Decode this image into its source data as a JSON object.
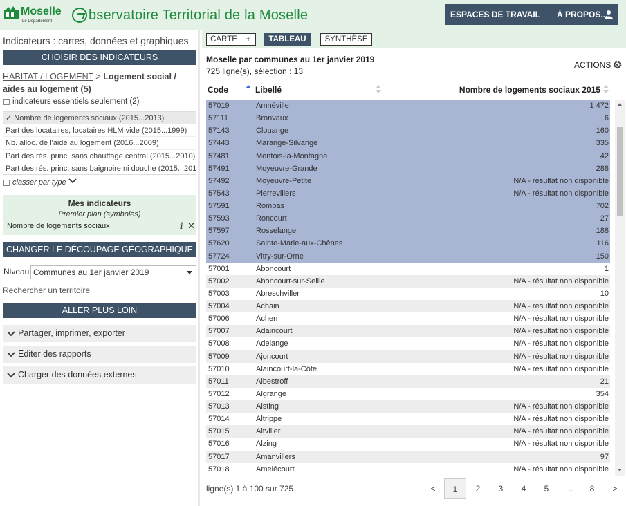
{
  "header": {
    "logo_text": "Moselle",
    "logo_sub": "Le Département",
    "site_title": "bservatoire Territorial de la Moselle",
    "nav": [
      "ESPACES DE TRAVAIL",
      "À PROPOS..."
    ],
    "user_icon": "user-icon"
  },
  "left": {
    "title": "Indicateurs : cartes, données et graphiques",
    "choose_header": "CHOISIR DES INDICATEURS",
    "crumb_link": "HABITAT / LOGEMENT",
    "crumb_sep": " > ",
    "crumb_current": "Logement social / aides au logement (5)",
    "essentials_label": "indicateurs essentiels seulement (2)",
    "indicators": [
      "✓ Nombre de logements sociaux (2015...2013)",
      "Part des locataires, locataires HLM vide (2015...1999)",
      "Nb. alloc. de l'aide au logement (2016...2009)",
      "Part des rés. princ. sans chauffage central (2015...2010)",
      "Part des rés. princ. sans baignoire ni douche (2015...2010)"
    ],
    "classer_label": "classer par type",
    "mes_title": "Mes indicateurs",
    "mes_plan": "Premier plan (symboles)",
    "mes_item": "Nombre de logements sociaux",
    "decoupage_header": "CHANGER LE DÉCOUPAGE GÉOGRAPHIQUE",
    "niveau_label": "Niveau",
    "niveau_value": "Communes au 1er janvier 2019",
    "search_link": "Rechercher un territoire",
    "further_header": "ALLER PLUS LOIN",
    "accordions": [
      "Partager, imprimer, exporter",
      "Editer des rapports",
      "Charger des données externes"
    ]
  },
  "right": {
    "tabs": [
      "CARTE",
      "+",
      "TABLEAU",
      "SYNTHÈSE"
    ],
    "active_tab": "TABLEAU",
    "table_title": "Moselle par communes au 1er janvier 2019",
    "count": "725 ligne(s), sélection : 13",
    "actions": "ACTIONS",
    "columns": [
      "Code",
      "Libellé",
      "Nombre de logements sociaux 2015"
    ],
    "rows": [
      {
        "code": "57019",
        "lib": "Amnéville",
        "val": "1 472",
        "sel": true
      },
      {
        "code": "57111",
        "lib": "Bronvaux",
        "val": "6",
        "sel": true
      },
      {
        "code": "57143",
        "lib": "Clouange",
        "val": "160",
        "sel": true
      },
      {
        "code": "57443",
        "lib": "Marange-Silvange",
        "val": "335",
        "sel": true
      },
      {
        "code": "57481",
        "lib": "Montois-la-Montagne",
        "val": "42",
        "sel": true
      },
      {
        "code": "57491",
        "lib": "Moyeuvre-Grande",
        "val": "288",
        "sel": true
      },
      {
        "code": "57492",
        "lib": "Moyeuvre-Petite",
        "val": "N/A - résultat non disponible",
        "sel": true
      },
      {
        "code": "57543",
        "lib": "Pierrevillers",
        "val": "N/A - résultat non disponible",
        "sel": true
      },
      {
        "code": "57591",
        "lib": "Rombas",
        "val": "702",
        "sel": true
      },
      {
        "code": "57593",
        "lib": "Roncourt",
        "val": "27",
        "sel": true
      },
      {
        "code": "57597",
        "lib": "Rosselange",
        "val": "188",
        "sel": true
      },
      {
        "code": "57620",
        "lib": "Sainte-Marie-aux-Chênes",
        "val": "116",
        "sel": true
      },
      {
        "code": "57724",
        "lib": "Vitry-sur-Orne",
        "val": "150",
        "sel": true
      },
      {
        "code": "57001",
        "lib": "Aboncourt",
        "val": "1",
        "sel": false
      },
      {
        "code": "57002",
        "lib": "Aboncourt-sur-Seille",
        "val": "N/A - résultat non disponible",
        "sel": false
      },
      {
        "code": "57003",
        "lib": "Abreschviller",
        "val": "10",
        "sel": false
      },
      {
        "code": "57004",
        "lib": "Achain",
        "val": "N/A - résultat non disponible",
        "sel": false
      },
      {
        "code": "57006",
        "lib": "Achen",
        "val": "N/A - résultat non disponible",
        "sel": false
      },
      {
        "code": "57007",
        "lib": "Adaincourt",
        "val": "N/A - résultat non disponible",
        "sel": false
      },
      {
        "code": "57008",
        "lib": "Adelange",
        "val": "N/A - résultat non disponible",
        "sel": false
      },
      {
        "code": "57009",
        "lib": "Ajoncourt",
        "val": "N/A - résultat non disponible",
        "sel": false
      },
      {
        "code": "57010",
        "lib": "Alaincourt-la-Côte",
        "val": "N/A - résultat non disponible",
        "sel": false
      },
      {
        "code": "57011",
        "lib": "Albestroff",
        "val": "21",
        "sel": false
      },
      {
        "code": "57012",
        "lib": "Algrange",
        "val": "354",
        "sel": false
      },
      {
        "code": "57013",
        "lib": "Alsting",
        "val": "N/A - résultat non disponible",
        "sel": false
      },
      {
        "code": "57014",
        "lib": "Altrippe",
        "val": "N/A - résultat non disponible",
        "sel": false
      },
      {
        "code": "57015",
        "lib": "Altviller",
        "val": "N/A - résultat non disponible",
        "sel": false
      },
      {
        "code": "57016",
        "lib": "Alzing",
        "val": "N/A - résultat non disponible",
        "sel": false
      },
      {
        "code": "57017",
        "lib": "Amanvillers",
        "val": "97",
        "sel": false
      },
      {
        "code": "57018",
        "lib": "Amelécourt",
        "val": "N/A - résultat non disponible",
        "sel": false
      }
    ],
    "footer": "ligne(s) 1 à 100 sur 725",
    "pager": [
      "<",
      "1",
      "2",
      "3",
      "4",
      "5",
      "...",
      "8",
      ">"
    ],
    "current_page": "1"
  },
  "colors": {
    "dark": "#3e5367",
    "green": "#1e8b3b",
    "mint": "#e4f1e6",
    "selected_row": "#a8b6d4"
  }
}
